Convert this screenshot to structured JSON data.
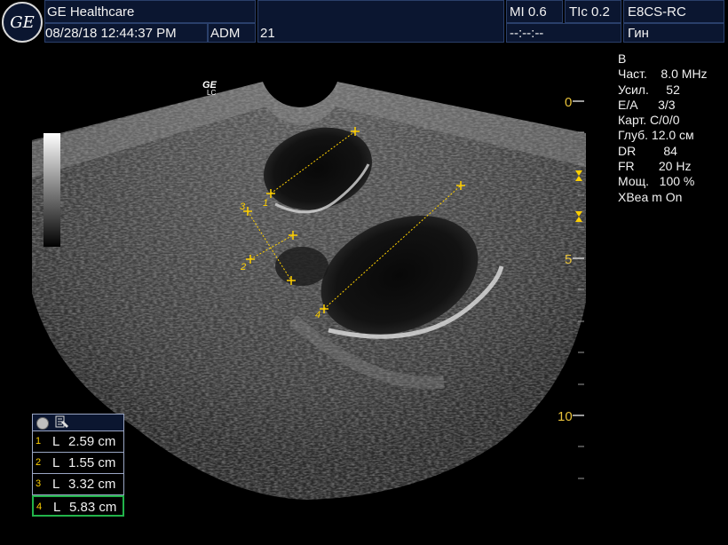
{
  "header": {
    "brand": "GE Healthcare",
    "datetime": "08/28/18 12:44:37 PM",
    "operator": "ADM",
    "frame": "21",
    "mi": "MI 0.6",
    "tic": "TIc 0.2",
    "probe": "E8CS-RC",
    "timer": "--:--:--",
    "preset": "Гин",
    "logo_text": "GE"
  },
  "params": [
    "В",
    "Част.    8.0 MHz",
    "Усил.     52",
    "E/A      3/3",
    "Карт. C/0/0",
    "Глуб. 12.0 см",
    "DR        84",
    "FR       20 Hz",
    "Мощ.   100 %",
    "XBea m On"
  ],
  "image": {
    "probe_mark": "GE",
    "probe_mark_sub": "LC",
    "depth_labels": [
      "0",
      "5",
      "10"
    ]
  },
  "calipers": [
    {
      "id": "1",
      "length_cm": 2.59
    },
    {
      "id": "2",
      "length_cm": 1.55
    },
    {
      "id": "3",
      "length_cm": 3.32
    },
    {
      "id": "4",
      "length_cm": 5.83
    }
  ],
  "measurements": {
    "rows": [
      {
        "num": "1",
        "label": "L",
        "value": "2.59 cm"
      },
      {
        "num": "2",
        "label": "L",
        "value": "1.55 cm"
      },
      {
        "num": "3",
        "label": "L",
        "value": "3.32 cm"
      },
      {
        "num": "4",
        "label": "L",
        "value": "5.83 cm"
      }
    ],
    "selected_index": 3
  },
  "colors": {
    "header_bg": "#0b1630",
    "caliper": "#ffd000",
    "selected": "#22b34a"
  }
}
